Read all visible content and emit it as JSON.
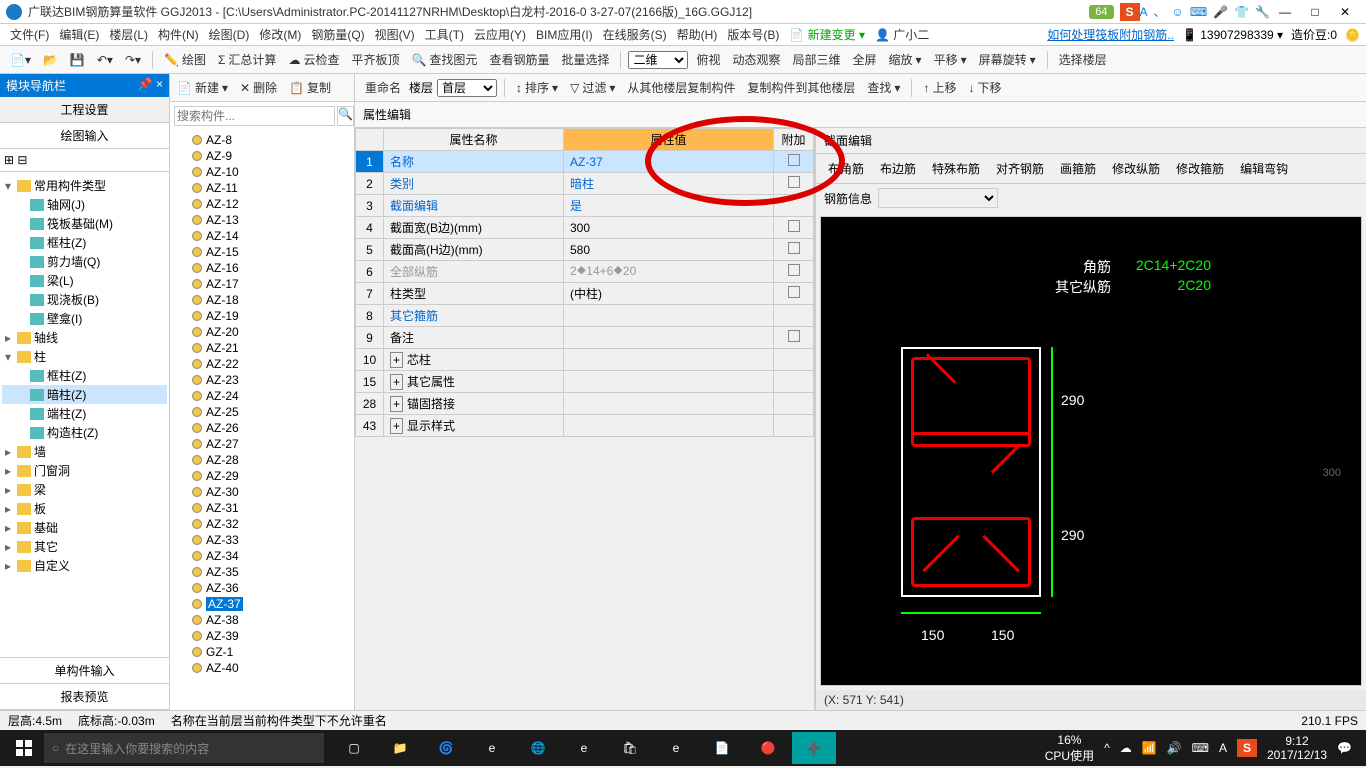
{
  "titlebar": {
    "title": "广联达BIM钢筋算量软件 GGJ2013 - [C:\\Users\\Administrator.PC-20141127NRHM\\Desktop\\白龙村-2016-0    3-27-07(2166版)_16G.GGJ12]",
    "badge": "64",
    "minimize": "—",
    "maximize": "□",
    "close": "✕"
  },
  "menubar": {
    "items": [
      "文件(F)",
      "编辑(E)",
      "楼层(L)",
      "构件(N)",
      "绘图(D)",
      "修改(M)",
      "钢筋量(Q)",
      "视图(V)",
      "工具(T)",
      "云应用(Y)",
      "BIM应用(I)",
      "在线服务(S)",
      "帮助(H)",
      "版本号(B)"
    ],
    "new_change": "新建变更",
    "user": "广小二",
    "help_link": "如何处理筏板附加钢筋..",
    "phone": "13907298339",
    "coin": "造价豆:0"
  },
  "toolbar1": {
    "items": [
      "绘图",
      "汇总计算",
      "云检查",
      "平齐板顶",
      "查找图元",
      "查看钢筋量",
      "批量选择"
    ],
    "view_mode": "二维",
    "items2": [
      "俯视",
      "动态观察",
      "局部三维",
      "全屏",
      "缩放",
      "平移",
      "屏幕旋转",
      "选择楼层"
    ]
  },
  "toolbar2": {
    "items": [
      "新建",
      "删除",
      "复制",
      "重命名"
    ],
    "floor_lbl": "楼层",
    "floor_val": "首层",
    "items2": [
      "排序",
      "过滤",
      "从其他楼层复制构件",
      "复制构件到其他楼层",
      "查找",
      "上移",
      "下移"
    ]
  },
  "nav": {
    "header": "模块导航栏",
    "tab1": "工程设置",
    "tab2": "绘图输入",
    "tree": [
      {
        "label": "常用构件类型",
        "expanded": true,
        "children": [
          {
            "label": "轴网(J)"
          },
          {
            "label": "筏板基础(M)"
          },
          {
            "label": "框柱(Z)"
          },
          {
            "label": "剪力墙(Q)"
          },
          {
            "label": "梁(L)"
          },
          {
            "label": "现浇板(B)"
          },
          {
            "label": "壁龛(I)"
          }
        ]
      },
      {
        "label": "轴线",
        "expanded": false
      },
      {
        "label": "柱",
        "expanded": true,
        "children": [
          {
            "label": "框柱(Z)"
          },
          {
            "label": "暗柱(Z)",
            "selected": true
          },
          {
            "label": "端柱(Z)"
          },
          {
            "label": "构造柱(Z)"
          }
        ]
      },
      {
        "label": "墙",
        "expanded": false
      },
      {
        "label": "门窗洞",
        "expanded": false
      },
      {
        "label": "梁",
        "expanded": false
      },
      {
        "label": "板",
        "expanded": false
      },
      {
        "label": "基础",
        "expanded": false
      },
      {
        "label": "其它",
        "expanded": false
      },
      {
        "label": "自定义",
        "expanded": false
      }
    ],
    "bottom1": "单构件输入",
    "bottom2": "报表预览"
  },
  "search": {
    "placeholder": "搜索构件..."
  },
  "components": [
    "AZ-8",
    "AZ-9",
    "AZ-10",
    "AZ-11",
    "AZ-12",
    "AZ-13",
    "AZ-14",
    "AZ-15",
    "AZ-16",
    "AZ-17",
    "AZ-18",
    "AZ-19",
    "AZ-20",
    "AZ-21",
    "AZ-22",
    "AZ-23",
    "AZ-24",
    "AZ-25",
    "AZ-26",
    "AZ-27",
    "AZ-28",
    "AZ-29",
    "AZ-30",
    "AZ-31",
    "AZ-32",
    "AZ-33",
    "AZ-34",
    "AZ-35",
    "AZ-36",
    "AZ-37",
    "AZ-38",
    "AZ-39",
    "GZ-1",
    "AZ-40"
  ],
  "selected_component": "AZ-37",
  "props": {
    "header": "属性编辑",
    "col_name": "属性名称",
    "col_value": "属性值",
    "col_attach": "附加",
    "rows": [
      {
        "n": "1",
        "name": "名称",
        "val": "AZ-37",
        "sel": true,
        "chk": false,
        "blue": true
      },
      {
        "n": "2",
        "name": "类别",
        "val": "暗柱",
        "chk": true,
        "blue": true
      },
      {
        "n": "3",
        "name": "截面编辑",
        "val": "是",
        "blue": true
      },
      {
        "n": "4",
        "name": "截面宽(B边)(mm)",
        "val": "300",
        "chk": true
      },
      {
        "n": "5",
        "name": "截面高(H边)(mm)",
        "val": "580",
        "chk": true
      },
      {
        "n": "6",
        "name": "全部纵筋",
        "val": "2⯁14+6⯁20",
        "chk": true,
        "gray": true
      },
      {
        "n": "7",
        "name": "柱类型",
        "val": "(中柱)",
        "chk": true
      },
      {
        "n": "8",
        "name": "其它箍筋",
        "val": "",
        "blue": true
      },
      {
        "n": "9",
        "name": "备注",
        "val": "",
        "chk": true
      },
      {
        "n": "10",
        "name": "芯柱",
        "val": "",
        "exp": true
      },
      {
        "n": "15",
        "name": "其它属性",
        "val": "",
        "exp": true
      },
      {
        "n": "28",
        "name": "锚固搭接",
        "val": "",
        "exp": true
      },
      {
        "n": "43",
        "name": "显示样式",
        "val": "",
        "exp": true
      }
    ]
  },
  "section": {
    "header": "截面编辑",
    "tabs": [
      "布角筋",
      "布边筋",
      "特殊布筋",
      "对齐钢筋",
      "画箍筋",
      "修改纵筋",
      "修改箍筋",
      "编辑弯钩"
    ],
    "info_label": "钢筋信息",
    "label_corner": "角筋",
    "label_other": "其它纵筋",
    "val_corner": "2C14+2C20",
    "val_other": "2C20",
    "dim_v1": "290",
    "dim_v2": "290",
    "dim_h1": "150",
    "dim_h2": "150",
    "axis_300": "300",
    "coord": "(X: 571 Y: 541)"
  },
  "statusbar": {
    "floor_h": "层高:4.5m",
    "bottom_h": "底标高:-0.03m",
    "msg": "名称在当前层当前构件类型下不允许重名",
    "fps": "210.1 FPS"
  },
  "taskbar": {
    "search_placeholder": "在这里输入你要搜索的内容",
    "cpu_pct": "16%",
    "cpu_label": "CPU使用",
    "time": "9:12",
    "date": "2017/12/13"
  }
}
